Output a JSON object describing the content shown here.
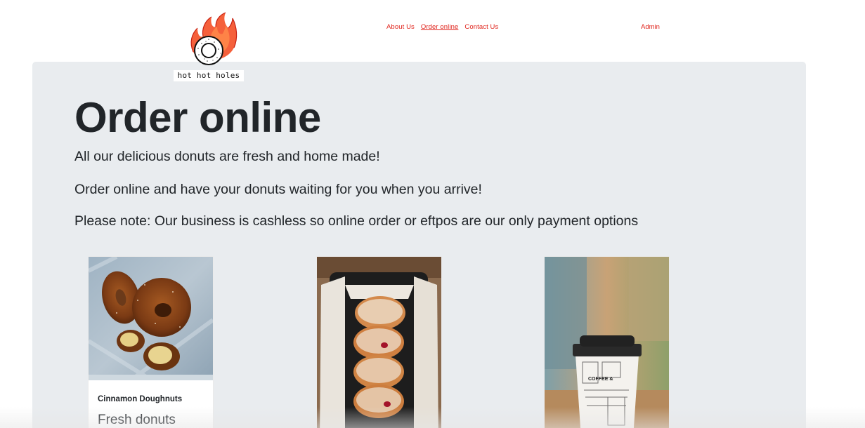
{
  "logo": {
    "text": "hot hot holes"
  },
  "nav": {
    "links": [
      {
        "label": "About Us"
      },
      {
        "label": "Order online"
      },
      {
        "label": "Contact Us"
      }
    ],
    "admin": "Admin"
  },
  "main": {
    "title": "Order online",
    "lead1": "All our delicious donuts are fresh and home made!",
    "lead2": "Order online and have your donuts waiting for you when you arrive!",
    "lead3": "Please note: Our business is cashless so online order or eftpos are our only payment options"
  },
  "products": [
    {
      "title": "Cinnamon Doughnuts",
      "text": "Fresh donuts"
    },
    {
      "title": "",
      "text": ""
    },
    {
      "title": "",
      "text": ""
    }
  ],
  "colors": {
    "accent": "#e0231b",
    "panel": "#e9ecef",
    "text": "#212529"
  }
}
